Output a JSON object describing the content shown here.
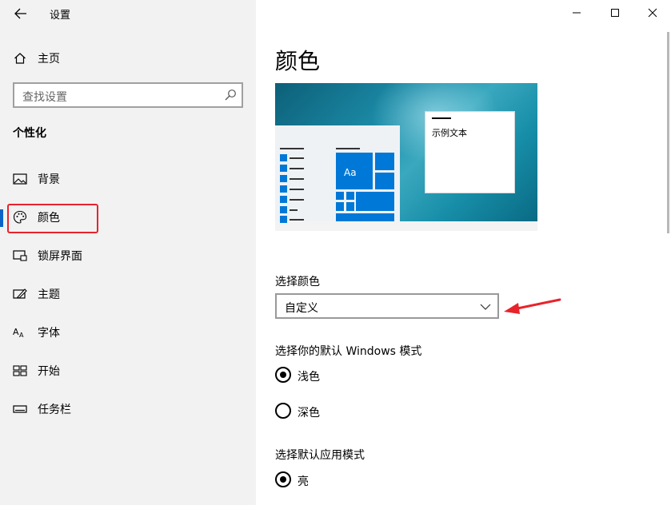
{
  "app": {
    "title": "设置"
  },
  "window_controls": {
    "minimize": "minimize-icon",
    "maximize": "maximize-icon",
    "close": "close-icon"
  },
  "sidebar": {
    "home_label": "主页",
    "search_placeholder": "查找设置",
    "section_heading": "个性化",
    "items": [
      {
        "label": "背景",
        "icon": "picture-icon"
      },
      {
        "label": "颜色",
        "icon": "palette-icon",
        "active": true
      },
      {
        "label": "锁屏界面",
        "icon": "lock-screen-icon"
      },
      {
        "label": "主题",
        "icon": "theme-icon"
      },
      {
        "label": "字体",
        "icon": "font-icon"
      },
      {
        "label": "开始",
        "icon": "start-icon"
      },
      {
        "label": "任务栏",
        "icon": "taskbar-icon"
      }
    ]
  },
  "main": {
    "title": "颜色",
    "preview": {
      "sample_text": "示例文本",
      "tile_text": "Aa"
    },
    "choose_color": {
      "label": "选择颜色",
      "selected": "自定义"
    },
    "windows_mode": {
      "label": "选择你的默认 Windows 模式",
      "options": [
        {
          "label": "浅色",
          "checked": true
        },
        {
          "label": "深色",
          "checked": false
        }
      ]
    },
    "app_mode": {
      "label": "选择默认应用模式",
      "options": [
        {
          "label": "亮",
          "checked": true
        }
      ]
    }
  },
  "colors": {
    "accent": "#0078d7",
    "highlight": "#e8232b",
    "sidebar_bg": "#f2f2f2"
  }
}
